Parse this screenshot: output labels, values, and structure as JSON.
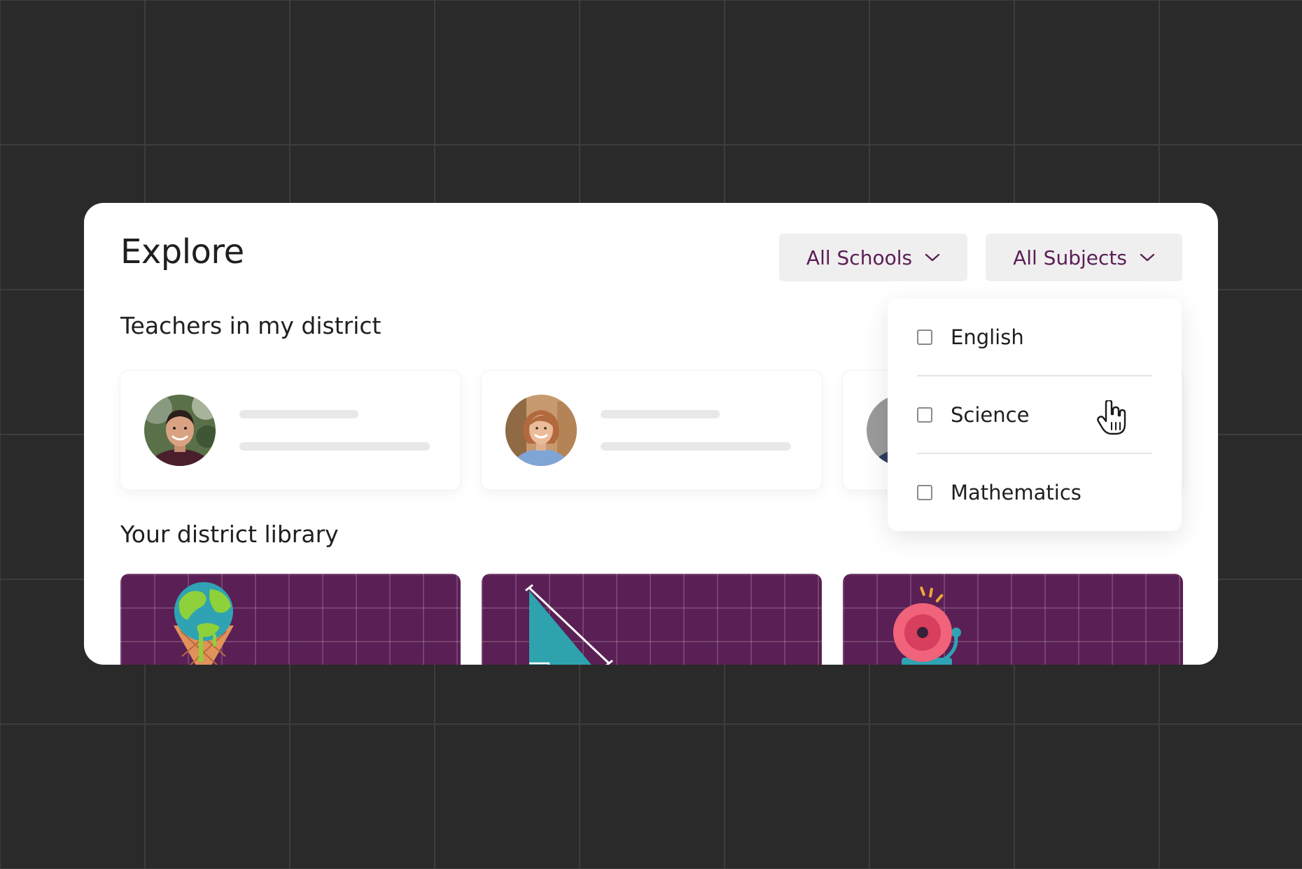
{
  "header": {
    "title": "Explore",
    "filters": {
      "schools_label": "All Schools",
      "subjects_label": "All Subjects"
    }
  },
  "sections": {
    "teachers_title": "Teachers in my district",
    "library_title": "Your district library"
  },
  "subjects_dropdown": {
    "options": [
      {
        "label": "English",
        "checked": false
      },
      {
        "label": "Science",
        "checked": false
      },
      {
        "label": "Mathematics",
        "checked": false
      }
    ]
  },
  "colors": {
    "brand_purple": "#5a1f54",
    "filter_text": "#5b1e54",
    "background": "#2a2a2a"
  },
  "icons": {
    "filter_chevron": "chevron-down-icon",
    "cursor": "hand-pointer-icon",
    "library_1": "ice-cream-globe-icon",
    "library_2": "triangle-ruler-icon",
    "library_3": "school-bell-icon"
  }
}
